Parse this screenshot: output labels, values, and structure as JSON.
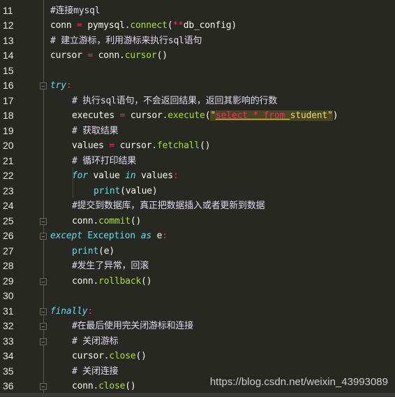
{
  "editor": {
    "theme_colors": {
      "background": "#272822",
      "comment": "#e2d8f2",
      "keyword": "#66d9ef",
      "function": "#a6e22e",
      "operator": "#f92672",
      "string": "#e6db74"
    },
    "lines": [
      {
        "num": "11",
        "indent": 0,
        "tokens": [
          [
            "#连接mysql",
            "cm"
          ]
        ]
      },
      {
        "num": "12",
        "indent": 0,
        "tokens": [
          [
            "conn ",
            "plain"
          ],
          [
            "=",
            "op"
          ],
          [
            " pymysql.",
            "plain"
          ],
          [
            "connect",
            "fn"
          ],
          [
            "(",
            "plain"
          ],
          [
            "**",
            "op"
          ],
          [
            "db_config)",
            "plain"
          ]
        ]
      },
      {
        "num": "13",
        "indent": 0,
        "tokens": [
          [
            "# 建立游标，利用游标来执行sql语句",
            "cm"
          ]
        ]
      },
      {
        "num": "14",
        "indent": 0,
        "tokens": [
          [
            "cursor ",
            "plain"
          ],
          [
            "=",
            "op"
          ],
          [
            " conn.",
            "plain"
          ],
          [
            "cursor",
            "fn"
          ],
          [
            "()",
            "plain"
          ]
        ]
      },
      {
        "num": "15",
        "indent": 0,
        "tokens": []
      },
      {
        "num": "16",
        "indent": 0,
        "tokens": [
          [
            "try",
            "kw"
          ],
          [
            ":",
            "op"
          ]
        ]
      },
      {
        "num": "17",
        "indent": 1,
        "tokens": [
          [
            "# 执行sql语句，不会返回结果，返回其影响的行数",
            "cm"
          ]
        ]
      },
      {
        "num": "18",
        "indent": 1,
        "tokens": [
          [
            "executes ",
            "plain"
          ],
          [
            "=",
            "op"
          ],
          [
            " cursor.",
            "plain"
          ],
          [
            "execute",
            "fn"
          ],
          [
            "(",
            "plain"
          ],
          [
            "\"",
            "st hl"
          ],
          [
            "select * from ",
            "sq hl"
          ],
          [
            "student",
            "st hl"
          ],
          [
            "\"",
            "st hl"
          ],
          [
            ")",
            "plain"
          ]
        ]
      },
      {
        "num": "19",
        "indent": 1,
        "tokens": [
          [
            "# 获取结果",
            "cm"
          ]
        ]
      },
      {
        "num": "20",
        "indent": 1,
        "tokens": [
          [
            "values ",
            "plain"
          ],
          [
            "=",
            "op"
          ],
          [
            " cursor.",
            "plain"
          ],
          [
            "fetchall",
            "fn"
          ],
          [
            "()",
            "plain"
          ]
        ]
      },
      {
        "num": "21",
        "indent": 1,
        "tokens": [
          [
            "# 循环打印结果",
            "cm"
          ]
        ]
      },
      {
        "num": "22",
        "indent": 1,
        "tokens": [
          [
            "for",
            "kw"
          ],
          [
            " value ",
            "plain"
          ],
          [
            "in",
            "kw"
          ],
          [
            " values",
            "plain"
          ],
          [
            ":",
            "op"
          ]
        ]
      },
      {
        "num": "23",
        "indent": 2,
        "tokens": [
          [
            "print",
            "cls"
          ],
          [
            "(value)",
            "plain"
          ]
        ]
      },
      {
        "num": "24",
        "indent": 1,
        "tokens": [
          [
            "#提交到数据库，真正把数据插入或者更新到数据",
            "cm"
          ]
        ]
      },
      {
        "num": "25",
        "indent": 1,
        "tokens": [
          [
            "conn.",
            "plain"
          ],
          [
            "commit",
            "fn"
          ],
          [
            "()",
            "plain"
          ]
        ]
      },
      {
        "num": "26",
        "indent": 0,
        "tokens": [
          [
            "except",
            "kw"
          ],
          [
            " ",
            "plain"
          ],
          [
            "Exception",
            "cls"
          ],
          [
            " ",
            "plain"
          ],
          [
            "as",
            "kw"
          ],
          [
            " e",
            "plain"
          ],
          [
            ":",
            "op"
          ]
        ]
      },
      {
        "num": "27",
        "indent": 1,
        "tokens": [
          [
            "print",
            "cls"
          ],
          [
            "(e)",
            "plain"
          ]
        ]
      },
      {
        "num": "28",
        "indent": 1,
        "tokens": [
          [
            "#发生了异常，回滚",
            "cm"
          ]
        ]
      },
      {
        "num": "29",
        "indent": 1,
        "tokens": [
          [
            "conn.",
            "plain"
          ],
          [
            "rollback",
            "fn"
          ],
          [
            "()",
            "plain"
          ]
        ]
      },
      {
        "num": "30",
        "indent": 0,
        "tokens": []
      },
      {
        "num": "31",
        "indent": 0,
        "tokens": [
          [
            "finally",
            "kw"
          ],
          [
            ":",
            "op"
          ]
        ]
      },
      {
        "num": "32",
        "indent": 1,
        "tokens": [
          [
            "#在最后使用完关闭游标和连接",
            "cm"
          ]
        ]
      },
      {
        "num": "33",
        "indent": 1,
        "tokens": [
          [
            "# 关闭游标",
            "cm"
          ]
        ]
      },
      {
        "num": "34",
        "indent": 1,
        "tokens": [
          [
            "cursor.",
            "plain"
          ],
          [
            "close",
            "fn"
          ],
          [
            "()",
            "plain"
          ]
        ]
      },
      {
        "num": "35",
        "indent": 1,
        "tokens": [
          [
            "# 关闭连接",
            "cm"
          ]
        ]
      },
      {
        "num": "36",
        "indent": 1,
        "tokens": [
          [
            "conn.",
            "plain"
          ],
          [
            "close",
            "fn"
          ],
          [
            "()",
            "plain"
          ]
        ]
      }
    ],
    "fold_lines": [
      "16",
      "25",
      "26",
      "29",
      "31",
      "32",
      "33",
      "36"
    ]
  },
  "watermark": "https://blog.csdn.net/weixin_43993089"
}
